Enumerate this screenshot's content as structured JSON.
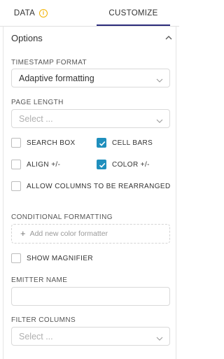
{
  "tabs": {
    "data_label": "DATA",
    "customize_label": "CUSTOMIZE"
  },
  "section": {
    "title": "Options"
  },
  "timestamp_format": {
    "label": "TIMESTAMP FORMAT",
    "value": "Adaptive formatting"
  },
  "page_length": {
    "label": "PAGE LENGTH",
    "placeholder": "Select ..."
  },
  "checkboxes": {
    "search_box": {
      "label": "SEARCH BOX",
      "checked": false
    },
    "cell_bars": {
      "label": "CELL BARS",
      "checked": true
    },
    "align": {
      "label": "ALIGN +/-",
      "checked": false
    },
    "color": {
      "label": "COLOR +/-",
      "checked": true
    },
    "allow_rearrange": {
      "label": "ALLOW COLUMNS TO BE REARRANGED",
      "checked": false
    },
    "show_magnifier": {
      "label": "SHOW MAGNIFIER",
      "checked": false
    }
  },
  "conditional_formatting": {
    "label": "CONDITIONAL FORMATTING",
    "add_label": "Add new color formatter"
  },
  "emitter_name": {
    "label": "EMITTER NAME",
    "value": ""
  },
  "filter_columns": {
    "label": "FILTER COLUMNS",
    "placeholder": "Select ..."
  },
  "colors": {
    "accent": "#1f8fbd",
    "warning": "#f2b200",
    "active_tab": "#2b2b7a"
  },
  "icons": {
    "info": "info-icon",
    "collapse": "chevron-up-icon",
    "dropdown": "chevron-down-icon",
    "check": "check-icon",
    "add": "plus-icon"
  }
}
